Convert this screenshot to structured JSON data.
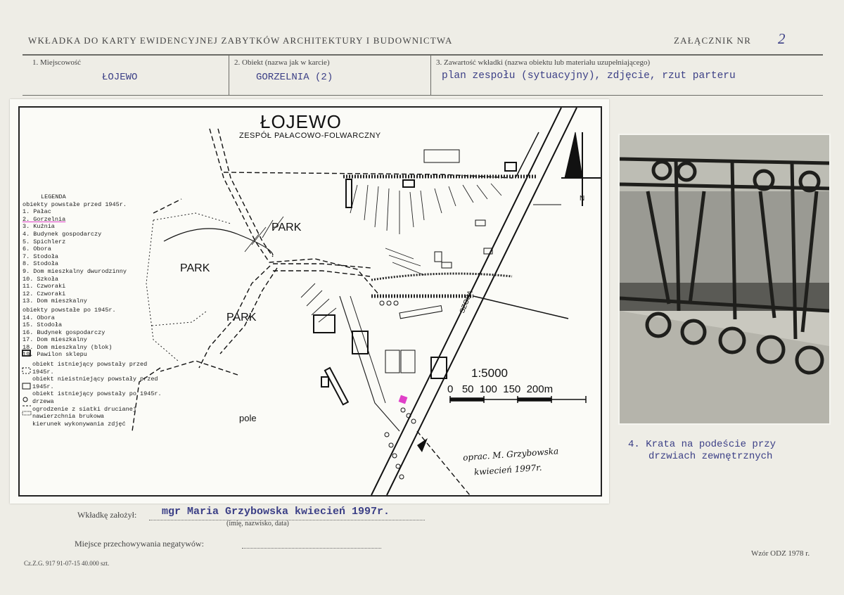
{
  "header": {
    "title": "WKŁADKA DO KARTY EWIDENCYJNEJ ZABYTKÓW ARCHITEKTURY I BUDOWNICTWA",
    "attachment_label": "ZAŁĄCZNIK NR",
    "attachment_number": "2"
  },
  "fields": {
    "locality_label": "1. Miejscowość",
    "locality_value": "ŁOJEWO",
    "object_label": "2. Obiekt (nazwa jak w karcie)",
    "object_value": "GORZELNIA (2)",
    "content_label": "3. Zawartość wkładki (nazwa obiektu lub materiału uzupełniającego)",
    "content_value": "plan zespołu (sytuacyjny), zdjęcie, rzut parteru"
  },
  "map": {
    "title": "ŁOJEWO",
    "subtitle": "ZESPÓŁ PAŁACOWO-FOLWARCZNY",
    "park1": "PARK",
    "park2": "PARK",
    "park3": "PARK",
    "field_label": "pole",
    "road_label": "SZOSA",
    "north_label": "N",
    "scale_ratio": "1:5000",
    "scale_ticks": "0   50  100  150  200m",
    "author_line1": "oprac. M. Grzybowska",
    "author_line2": "kwiecień 1997r.",
    "legend_title": "LEGENDA",
    "legend_before_header": "obiekty powstałe przed 1945r.",
    "legend_before": [
      "1. Pałac",
      "2. Gorzelnia",
      "3. Kuźnia",
      "4. Budynek gospodarczy",
      "5. Spichlerz",
      "6. Obora",
      "7. Stodoła",
      "8. Stodoła",
      "9. Dom mieszkalny dwurodzinny",
      "10. Szkoła",
      "11. Czworaki",
      "12. Czworaki",
      "13. Dom mieszkalny"
    ],
    "legend_after_header": "obiekty powstałe po 1945r.",
    "legend_after": [
      "14. Obora",
      "15. Stodoła",
      "16. Budynek gospodarczy",
      "17. Dom mieszkalny",
      "18. Dom mieszkalny (blok)",
      "19. Pawilon sklepu"
    ],
    "legend_symbols": [
      "obiekt istniejący powstały przed 1945r.",
      "obiekt nieistniejący powstały przed 1945r.",
      "obiekt istniejący powstały po 1945r.",
      "drzewa",
      "ogrodzenie z siatki drucianej",
      "nawierzchnia brukowa",
      "kierunek wykonywania zdjęć"
    ]
  },
  "photo": {
    "caption_line1": "4. Krata na podeście przy",
    "caption_line2": "drzwiach zewnętrznych"
  },
  "footer": {
    "founder_label": "Wkładkę założył:",
    "founder_value": "mgr Maria Grzybowska kwiecień 1997r.",
    "founder_hint": "(imię, nazwisko, data)",
    "negatives_label": "Miejsce przechowywania negatywów:",
    "print_info": "Cz.Z.G. 917 91-07-15 40.000 szt.",
    "form_model": "Wzór ODZ 1978 r."
  },
  "colors": {
    "typed_ink": "#3b3f86",
    "highlight": "#e040c8"
  }
}
